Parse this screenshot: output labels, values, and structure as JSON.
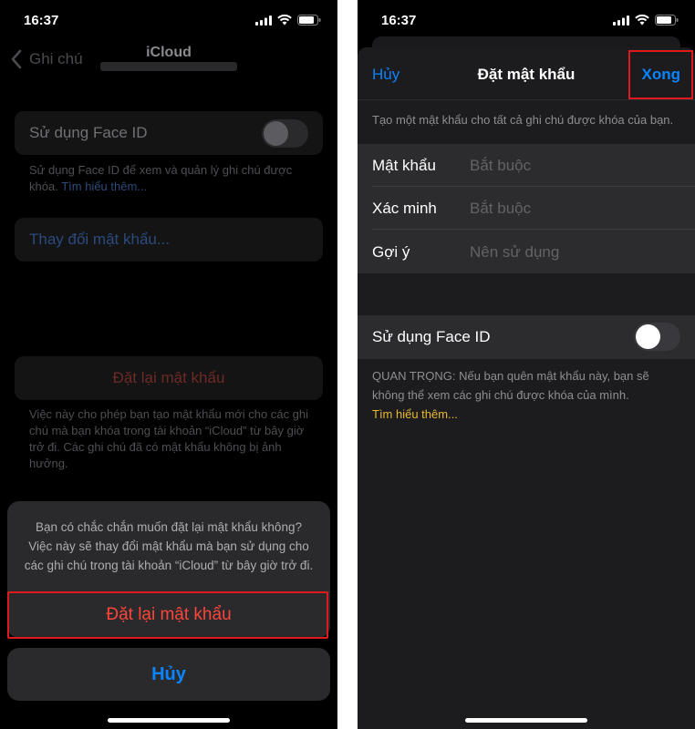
{
  "left_screen": {
    "status_time": "16:37",
    "nav": {
      "back_label": "Ghi chú",
      "title": "iCloud"
    },
    "faceid": {
      "label": "Sử dụng Face ID",
      "enabled": false,
      "note": "Sử dụng Face ID để xem và quản lý ghi chú được khóa.",
      "link": "Tìm hiểu thêm..."
    },
    "change_password": "Thay đổi mật khẩu...",
    "reset_password": "Đặt lại mật khẩu",
    "reset_note": "Việc này cho phép bạn tạo mật khẩu mới cho các ghi chú mà bạn khóa trong tài khoản “iCloud” từ bây giờ trở đi. Các ghi chú đã có mật khẩu không bị ảnh hưởng.",
    "action_sheet": {
      "message": "Bạn có chắc chắn muốn đặt lại mật khẩu không? Việc này sẽ thay đổi mật khẩu mà bạn sử dụng cho các ghi chú trong tài khoản “iCloud” từ bây giờ trở đi.",
      "confirm_label": "Đặt lại mật khẩu",
      "cancel_label": "Hủy"
    }
  },
  "right_screen": {
    "status_time": "16:37",
    "modal": {
      "cancel_label": "Hủy",
      "title": "Đặt mật khẩu",
      "done_label": "Xong",
      "description": "Tạo một mật khẩu cho tất cả ghi chú được khóa của bạn.",
      "fields": [
        {
          "label": "Mật khẩu",
          "placeholder": "Bắt buộc",
          "value": ""
        },
        {
          "label": "Xác minh",
          "placeholder": "Bắt buộc",
          "value": ""
        },
        {
          "label": "Gợi ý",
          "placeholder": "Nên sử dụng",
          "value": ""
        }
      ],
      "faceid_label": "Sử dụng Face ID",
      "faceid_enabled": false,
      "important_note": "QUAN TRỌNG: Nếu bạn quên mật khẩu này, bạn sẽ không thể xem các ghi chú được khóa của mình.",
      "learn_more": "Tìm hiểu thêm..."
    }
  },
  "colors": {
    "accent_blue": "#0a84ff",
    "destructive_red": "#ff453a",
    "highlight_red": "#e0191c",
    "link_yellow": "#e8b931"
  }
}
